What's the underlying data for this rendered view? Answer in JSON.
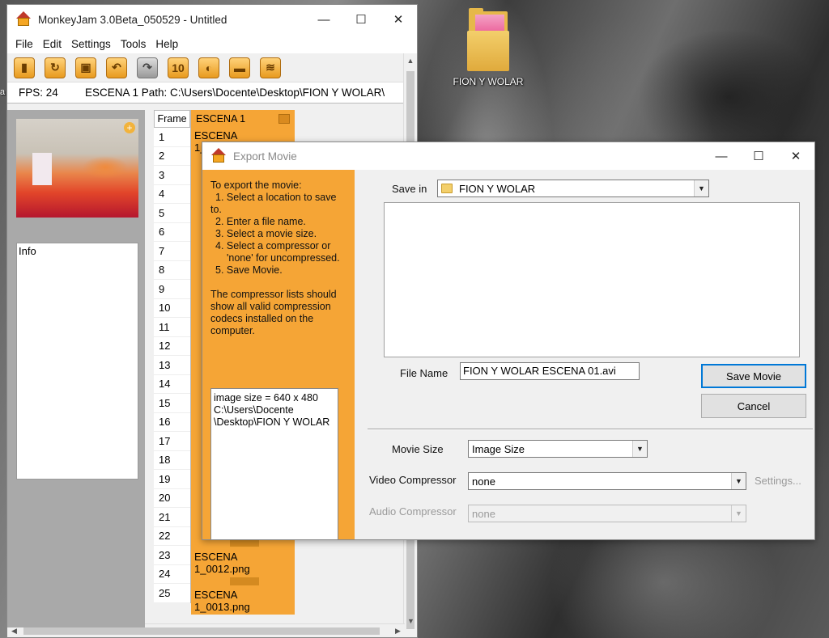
{
  "desktop": {
    "folder_label": "FION Y WOLAR",
    "edge_char": "a"
  },
  "main_window": {
    "title": "MonkeyJam 3.0Beta_050529 - Untitled",
    "controls": {
      "minimize": "—",
      "maximize": "☐",
      "close": "✕"
    },
    "menu": [
      "File",
      "Edit",
      "Settings",
      "Tools",
      "Help"
    ],
    "toolbar_icons": [
      "new-icon",
      "open-icon",
      "save-icon",
      "undo-icon",
      "redo-icon",
      "ten-icon",
      "capture-icon",
      "camera-icon",
      "export-icon"
    ],
    "toolbar_ten_label": "10",
    "fps_label": "FPS: 24",
    "path_label": "ESCENA 1 Path: C:\\Users\\Docente\\Desktop\\FION Y WOLAR\\",
    "info_label": "Info",
    "frame_header": "Frame",
    "scene_header": "ESCENA 1",
    "frames": [
      "1",
      "2",
      "3",
      "4",
      "5",
      "6",
      "7",
      "8",
      "9",
      "10",
      "11",
      "12",
      "13",
      "14",
      "15",
      "16",
      "17",
      "18",
      "19",
      "20",
      "21",
      "22",
      "23",
      "24",
      "25"
    ],
    "scene_first_cell": "ESCENA 1_0001.png",
    "scene_cell_23": "ESCENA 1_0012.png",
    "scene_cell_25": "ESCENA 1_0013.png"
  },
  "export_dialog": {
    "title": "Export Movie",
    "controls": {
      "minimize": "—",
      "maximize": "☐",
      "close": "✕"
    },
    "instructions_title": "To export the movie:",
    "steps": [
      "1. Select a location to save",
      "to.",
      "2. Enter a file name.",
      "3. Select a movie size.",
      "4. Select a compressor or",
      "'none' for uncompressed.",
      "5. Save Movie."
    ],
    "note": "The compressor lists should show all valid compression codecs installed on the computer.",
    "size_info": [
      "image size = 640 x 480",
      "C:\\Users\\Docente",
      "\\Desktop\\FION Y WOLAR"
    ],
    "save_in_label": "Save in",
    "save_in_value": "FION Y WOLAR",
    "file_name_label": "File Name",
    "file_name_value": "FION Y WOLAR ESCENA 01.avi",
    "save_button": "Save Movie",
    "cancel_button": "Cancel",
    "movie_size_label": "Movie Size",
    "movie_size_value": "Image Size",
    "video_compressor_label": "Video Compressor",
    "video_compressor_value": "none",
    "settings_label": "Settings...",
    "audio_compressor_label": "Audio Compressor",
    "audio_compressor_value": "none"
  }
}
